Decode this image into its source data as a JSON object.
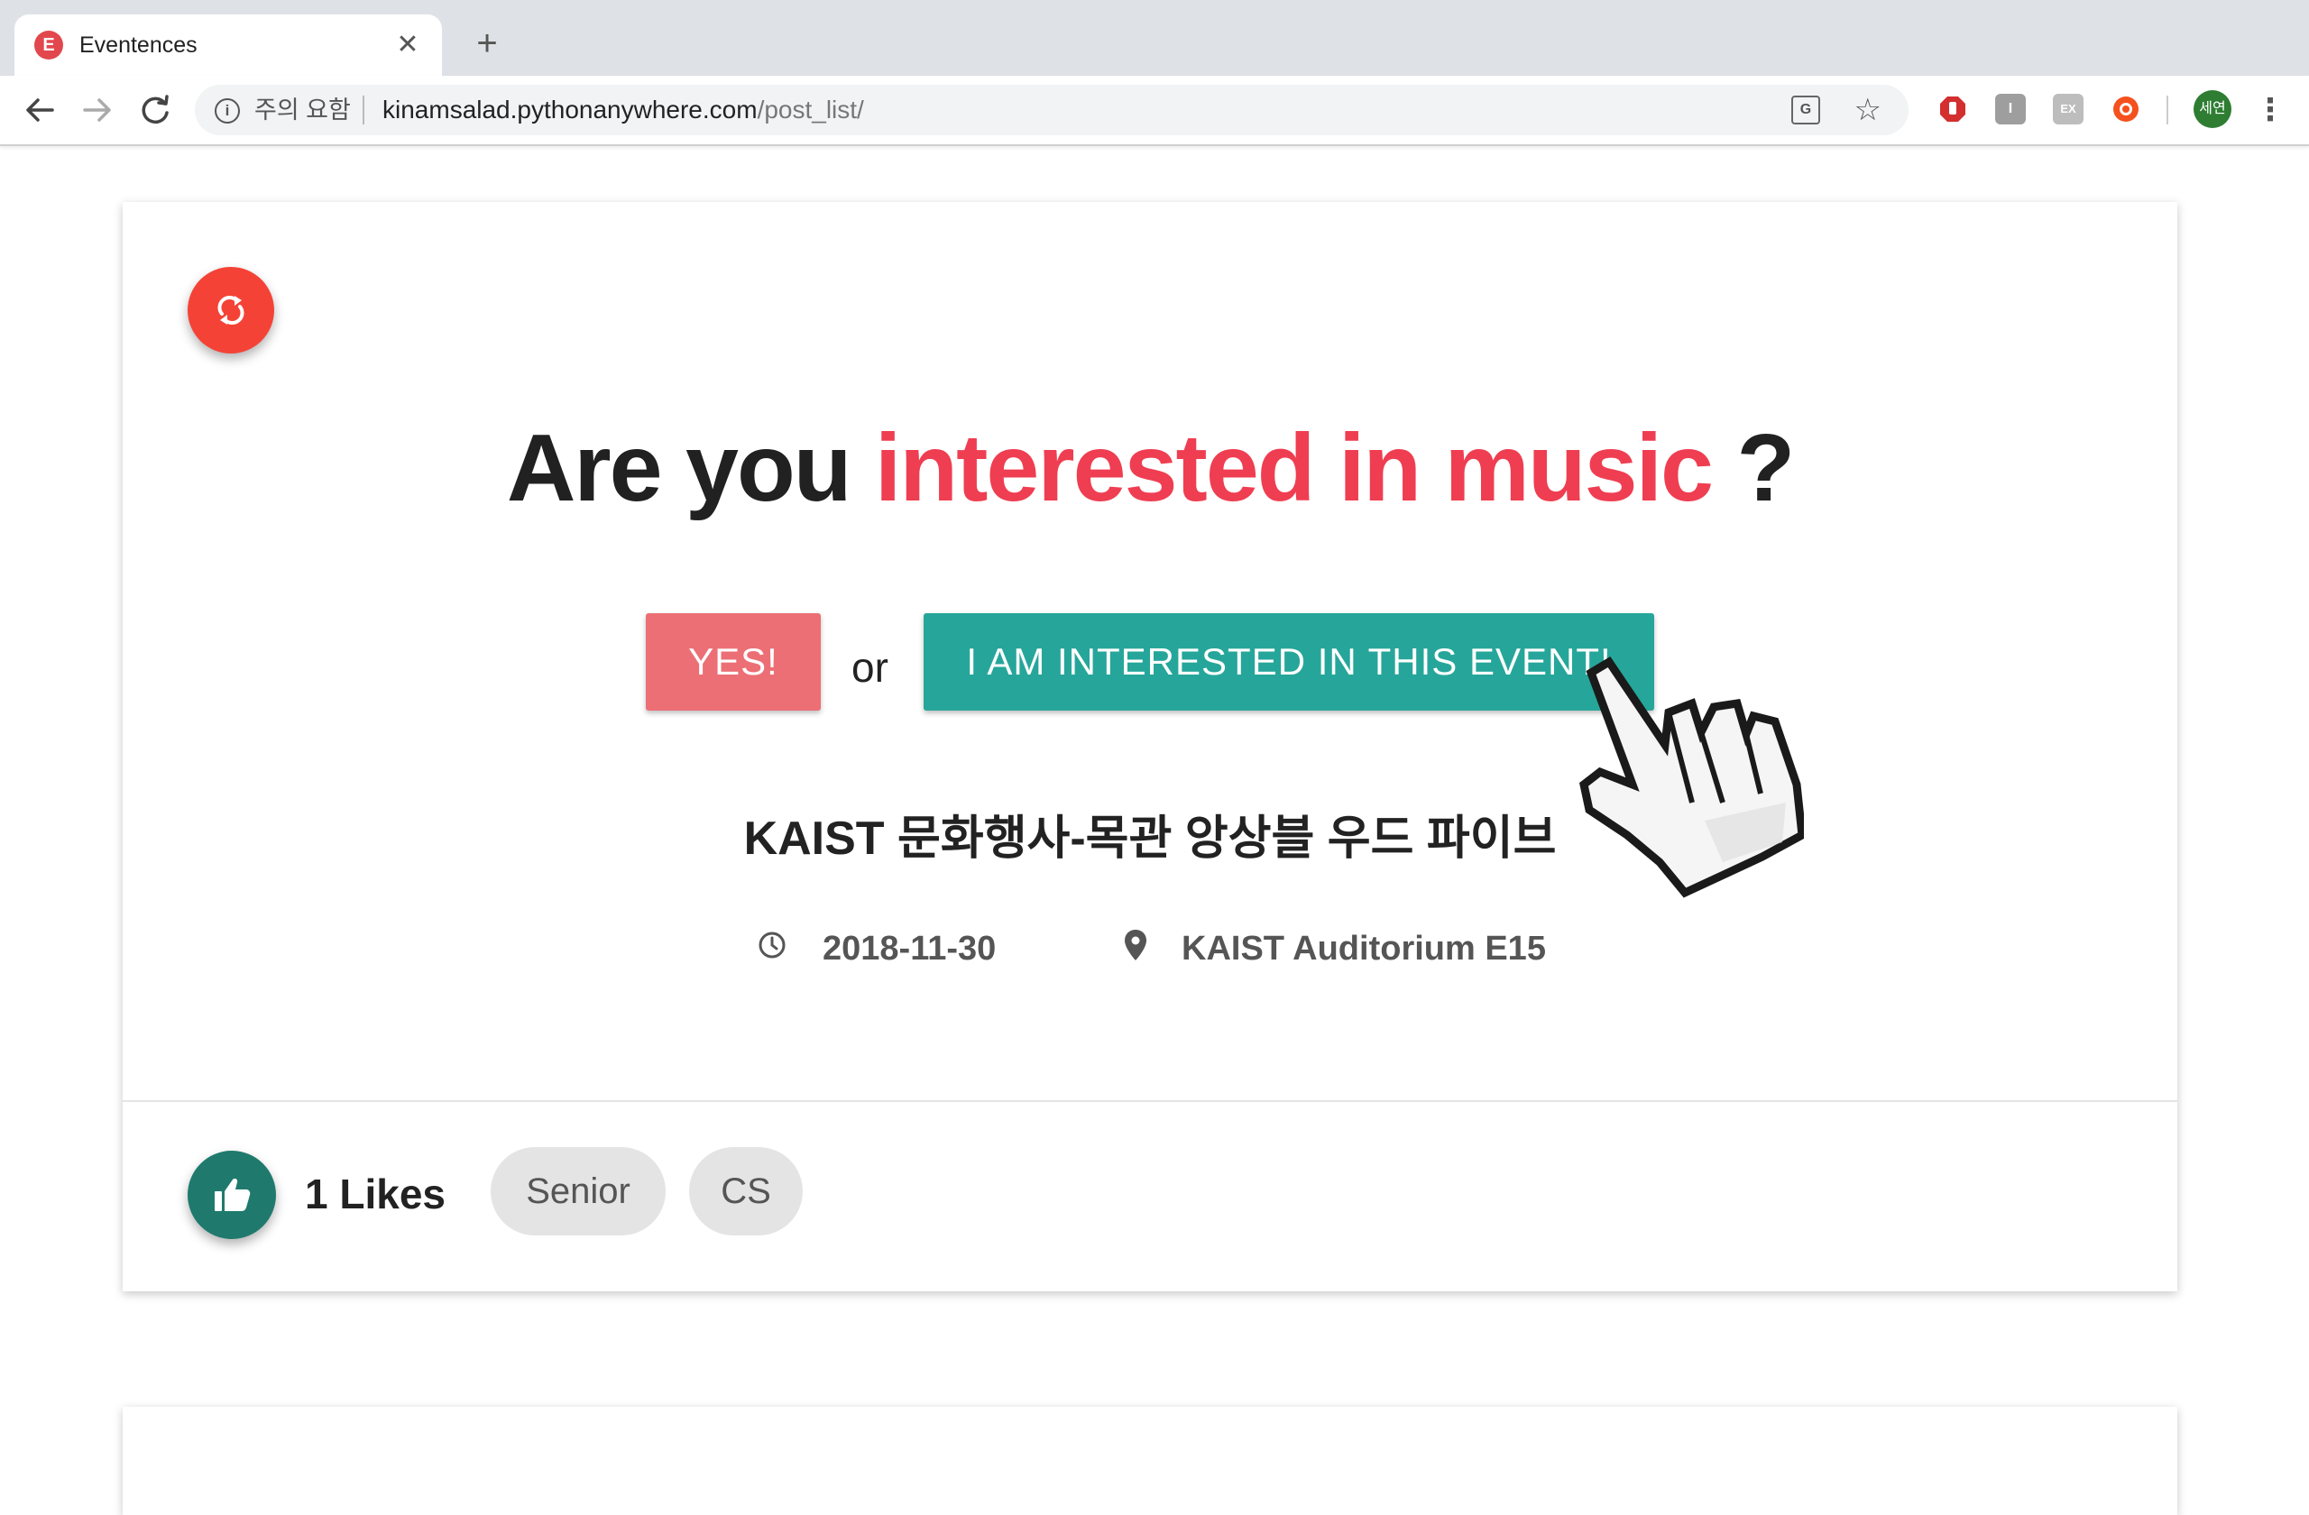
{
  "browser": {
    "tab": {
      "title": "Eventences",
      "favicon_letter": "E"
    },
    "security_label": "주의 요함",
    "url_host": "kinamsalad.pythonanywhere.com",
    "url_path": "/post_list/",
    "extensions": [
      "adblock-icon",
      "instapaper-icon",
      "ex-icon",
      "screenshot-icon"
    ],
    "profile_initials": "세연"
  },
  "question": {
    "prefix": "Are you",
    "highlight": "interested in music",
    "suffix": "?",
    "accent_color": "#ef3e51"
  },
  "actions": {
    "yes_label": "YES!",
    "or_label": "or",
    "interested_label": "I AM INTERESTED IN THIS EVENT!"
  },
  "event": {
    "title": "KAIST 문화행사-목관 앙상블 우드 파이브",
    "date": "2018-11-30",
    "location": "KAIST Auditorium E15"
  },
  "footer": {
    "likes_label": "1 Likes",
    "tags": [
      "Senior",
      "CS"
    ]
  },
  "colors": {
    "yes_button": "#ec6f75",
    "interested_button": "#26a69a",
    "refresh_fab": "#f44336",
    "like_fab": "#1f7a6d"
  }
}
